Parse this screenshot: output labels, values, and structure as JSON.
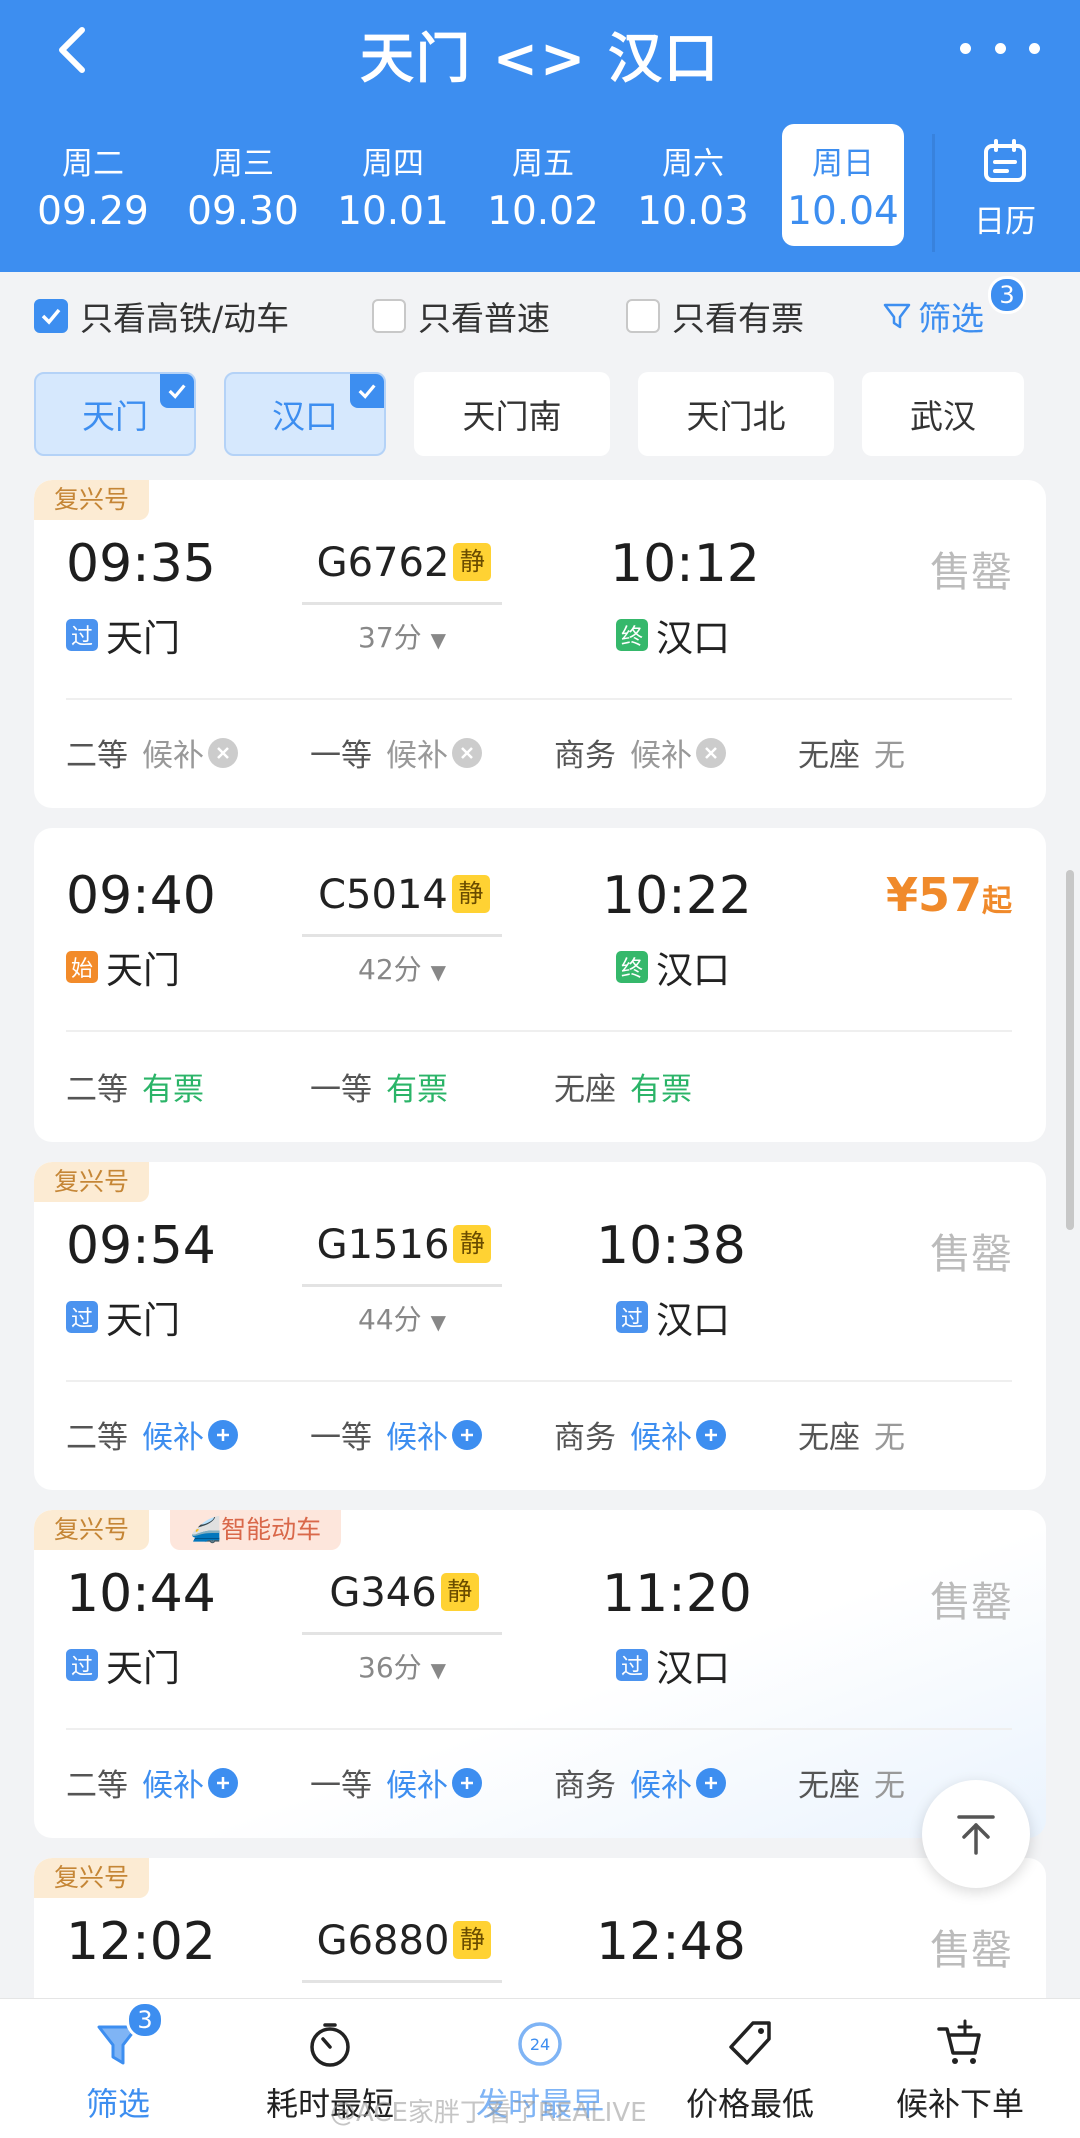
{
  "header": {
    "title": "天门 <> 汉口",
    "dates": [
      {
        "weekday": "周二",
        "date": "09.29"
      },
      {
        "weekday": "周三",
        "date": "09.30"
      },
      {
        "weekday": "周四",
        "date": "10.01"
      },
      {
        "weekday": "周五",
        "date": "10.02"
      },
      {
        "weekday": "周六",
        "date": "10.03"
      },
      {
        "weekday": "周日",
        "date": "10.04"
      }
    ],
    "calendar_label": "日历",
    "accent_color": "#3d8ef0"
  },
  "filters": {
    "high_speed_only": "只看高铁/动车",
    "normal_only": "只看普速",
    "available_only": "只看有票",
    "filter_label": "筛选",
    "filter_count": "3"
  },
  "stations": [
    "天门",
    "汉口",
    "天门南",
    "天门北",
    "武汉"
  ],
  "trains": [
    {
      "tags": [
        "复兴号"
      ],
      "dep_time": "09:35",
      "dep_mark": "过",
      "dep_station": "天门",
      "train_no": "G6762",
      "quiet": "静",
      "duration": "37分",
      "arr_time": "10:12",
      "arr_mark": "终",
      "arr_station": "汉口",
      "price": "售罄",
      "seats": [
        {
          "name": "二等",
          "status": "候补"
        },
        {
          "name": "一等",
          "status": "候补"
        },
        {
          "name": "商务",
          "status": "候补"
        },
        {
          "name": "无座",
          "status": "无"
        }
      ]
    },
    {
      "tags": [],
      "dep_time": "09:40",
      "dep_mark": "始",
      "dep_station": "天门",
      "train_no": "C5014",
      "quiet": "静",
      "duration": "42分",
      "arr_time": "10:22",
      "arr_mark": "终",
      "arr_station": "汉口",
      "price": "¥57",
      "price_suffix": "起",
      "seats": [
        {
          "name": "二等",
          "status": "有票"
        },
        {
          "name": "一等",
          "status": "有票"
        },
        {
          "name": "无座",
          "status": "有票"
        }
      ]
    },
    {
      "tags": [
        "复兴号"
      ],
      "dep_time": "09:54",
      "dep_mark": "过",
      "dep_station": "天门",
      "train_no": "G1516",
      "quiet": "静",
      "duration": "44分",
      "arr_time": "10:38",
      "arr_mark": "过",
      "arr_station": "汉口",
      "price": "售罄",
      "seats": [
        {
          "name": "二等",
          "status": "候补"
        },
        {
          "name": "一等",
          "status": "候补"
        },
        {
          "name": "商务",
          "status": "候补"
        },
        {
          "name": "无座",
          "status": "无"
        }
      ]
    },
    {
      "tags": [
        "复兴号",
        "智能动车"
      ],
      "dep_time": "10:44",
      "dep_mark": "过",
      "dep_station": "天门",
      "train_no": "G346",
      "quiet": "静",
      "duration": "36分",
      "arr_time": "11:20",
      "arr_mark": "过",
      "arr_station": "汉口",
      "price": "售罄",
      "seats": [
        {
          "name": "二等",
          "status": "候补"
        },
        {
          "name": "一等",
          "status": "候补"
        },
        {
          "name": "商务",
          "status": "候补"
        },
        {
          "name": "无座",
          "status": "无"
        }
      ]
    },
    {
      "tags": [
        "复兴号"
      ],
      "dep_time": "12:02",
      "train_no": "G6880",
      "quiet": "静",
      "arr_time": "12:48",
      "price": "售罄"
    }
  ],
  "bottom_tabs": [
    {
      "label": "筛选",
      "badge": "3"
    },
    {
      "label": "耗时最短"
    },
    {
      "label": "发时最早",
      "icon_text": "24"
    },
    {
      "label": "价格最低"
    },
    {
      "label": "候补下单"
    }
  ],
  "watermark": "@ACE家胖丁看了REALIVE"
}
